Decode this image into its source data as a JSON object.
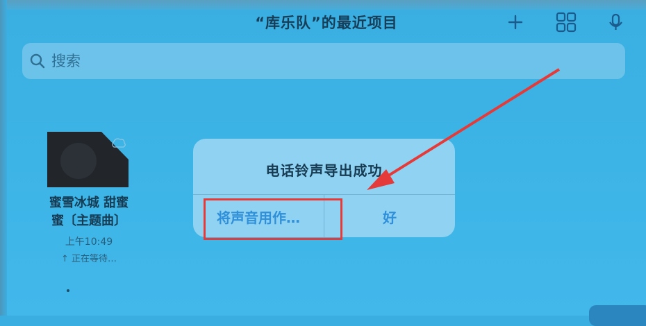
{
  "nav": {
    "title": "“库乐队”的最近项目"
  },
  "icons": {
    "add": "plus-icon",
    "grid": "grid-icon",
    "mic": "microphone-icon",
    "search": "search-icon"
  },
  "search": {
    "placeholder": "搜索"
  },
  "file": {
    "name_line1": "蜜雪冰城 甜蜜",
    "name_line2": "蜜〔主题曲〕",
    "time": "上午10:49",
    "status": "↑ 正在等待…"
  },
  "alert": {
    "title": "电话铃声导出成功",
    "left_button": "将声音用作…",
    "right_button": "好"
  },
  "colors": {
    "annotation_red": "#e53a3a",
    "accent_blue": "#2f8fd9"
  }
}
